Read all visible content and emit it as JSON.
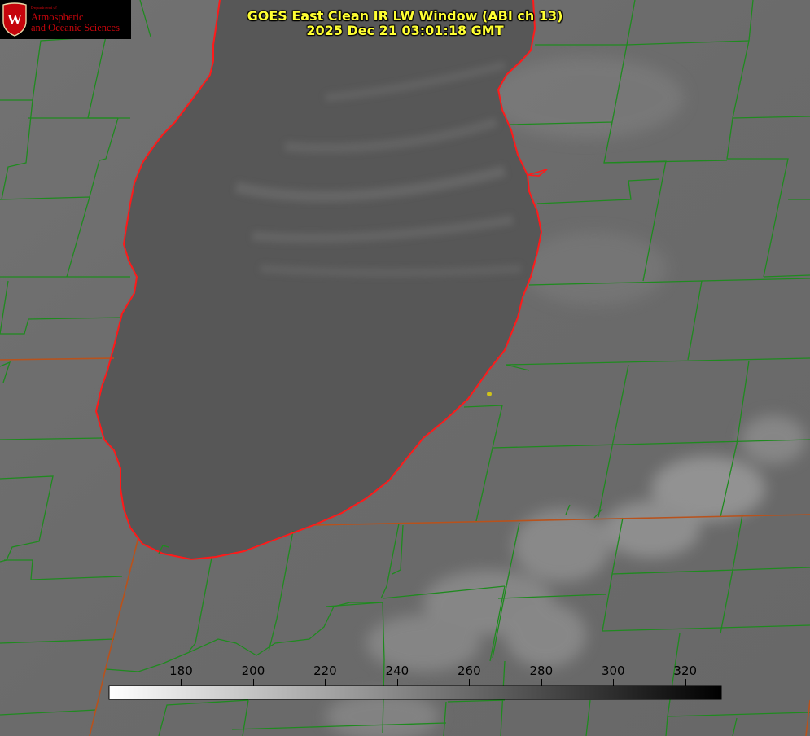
{
  "header": {
    "logo": {
      "dept": "Department of",
      "line1": "Atmospheric",
      "line2": "and Oceanic Sciences",
      "seal_letter": "W",
      "color": "#c5050c"
    },
    "title_line1": "GOES East Clean IR LW Window (ABI ch 13)",
    "title_line2": "2025 Dec 21 03:01:18 GMT",
    "title_color": "#ffff33"
  },
  "map": {
    "feature": "lake",
    "land_color": "#6a6a6a",
    "lake_color": "#575757",
    "county_border_color": "#1f8a1f",
    "state_border_color": "#b8521c",
    "shoreline_color": "#ff1a1a",
    "marker_color": "#cfc31a"
  },
  "colorbar": {
    "unit_min": 160,
    "unit_max": 330,
    "ticks": [
      180,
      200,
      220,
      240,
      260,
      280,
      300,
      320
    ],
    "gradient_start": "#ffffff",
    "gradient_end": "#000000"
  }
}
